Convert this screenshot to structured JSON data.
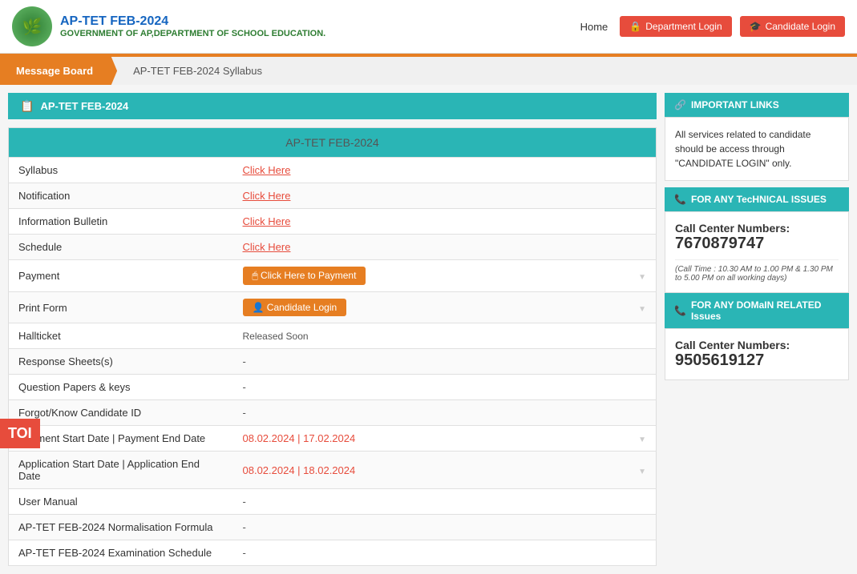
{
  "header": {
    "logo_emoji": "🌿",
    "main_title": "AP-TET FEB-2024",
    "sub_title": "GOVERNMENT OF AP,DEPARTMENT OF SCHOOL EDUCATION.",
    "home_label": "Home",
    "dept_login_label": "Department Login",
    "dept_login_icon": "🔒",
    "candidate_login_label": "Candidate Login",
    "candidate_login_icon": "🎓"
  },
  "tabs": [
    {
      "label": "Message Board",
      "active": true
    },
    {
      "label": "AP-TET FEB-2024 Syllabus",
      "active": false
    }
  ],
  "left_section": {
    "header_icon": "📋",
    "header_label": "AP-TET FEB-2024",
    "table_title": "AP-TET FEB-2024",
    "rows": [
      {
        "label": "Syllabus",
        "value": "Click Here",
        "type": "link"
      },
      {
        "label": "Notification",
        "value": "Click Here",
        "type": "link"
      },
      {
        "label": "Information Bulletin",
        "value": "Click Here",
        "type": "link"
      },
      {
        "label": "Schedule",
        "value": "Click Here",
        "type": "link"
      },
      {
        "label": "Payment",
        "value": "Click Here to Payment",
        "type": "button-payment"
      },
      {
        "label": "Print Form",
        "value": "Candidate Login",
        "type": "button-candidate"
      },
      {
        "label": "Hallticket",
        "value": "Released Soon",
        "type": "text"
      },
      {
        "label": "Response Sheets(s)",
        "value": "-",
        "type": "dash"
      },
      {
        "label": "Question Papers & keys",
        "value": "-",
        "type": "dash"
      },
      {
        "label": "Forgot/Know Candidate ID",
        "value": "-",
        "type": "dash"
      },
      {
        "label": "Payment Start Date | Payment End Date",
        "value": "08.02.2024 | 17.02.2024",
        "type": "date"
      },
      {
        "label": "Application Start Date | Application End Date",
        "value": "08.02.2024 | 18.02.2024",
        "type": "date"
      },
      {
        "label": "User Manual",
        "value": "-",
        "type": "dash"
      },
      {
        "label": "AP-TET FEB-2024 Normalisation Formula",
        "value": "-",
        "type": "dash"
      },
      {
        "label": "AP-TET FEB-2024 Examination Schedule",
        "value": "-",
        "type": "dash"
      }
    ]
  },
  "right_section": {
    "important_links_icon": "🔗",
    "important_links_label": "IMPORTANT LINKS",
    "info_text": "All services related to candidate should be access through \"CANDIDATE LOGIN\" only.",
    "technical_icon": "📞",
    "technical_label": "FOR ANY TecHNICAL ISSUES",
    "technical_call_label": "Call Center Numbers:",
    "technical_number": "7670879747",
    "technical_time": "(Call Time : 10.30 AM to 1.00 PM & 1.30 PM to 5.00 PM on all working days)",
    "domain_icon": "📞",
    "domain_label": "FOR ANY DOMaIN RELATED Issues",
    "domain_call_label": "Call Center Numbers:",
    "domain_number": "9505619127"
  },
  "toi_label": "TOI"
}
